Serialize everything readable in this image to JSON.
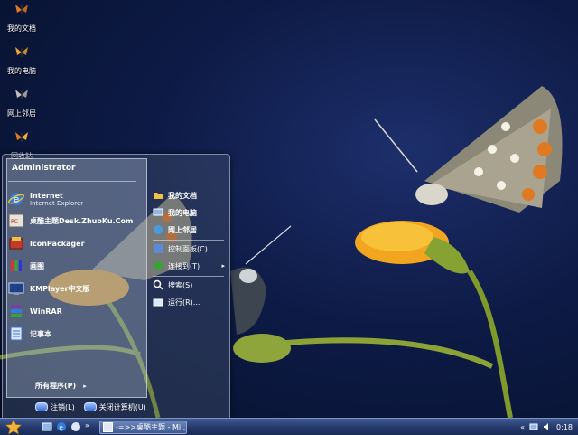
{
  "desktop": {
    "icons": [
      {
        "label": "我的文档",
        "icon": "butterfly-documents-icon"
      },
      {
        "label": "我的电脑",
        "icon": "butterfly-computer-icon"
      },
      {
        "label": "网上邻居",
        "icon": "butterfly-network-icon"
      },
      {
        "label": "回收站",
        "icon": "butterfly-recycle-icon"
      }
    ]
  },
  "start_menu": {
    "user": "Administrator",
    "pinned": [
      {
        "label": "Internet",
        "sub": "Internet Explorer",
        "icon": "ie-icon"
      },
      {
        "label": "桌酷主题Desk.ZhuoKu.Com",
        "icon": "desktop-theme-icon"
      },
      {
        "label": "IconPackager",
        "icon": "iconpackager-icon"
      },
      {
        "label": "画图",
        "icon": "paint-icon"
      },
      {
        "label": "KMPlayer中文版",
        "icon": "kmplayer-icon"
      },
      {
        "label": "WinRAR",
        "icon": "winrar-icon"
      },
      {
        "label": "记事本",
        "icon": "notepad-icon"
      }
    ],
    "all_programs": "所有程序(P)",
    "right": [
      {
        "label": "我的文档",
        "icon": "documents-icon"
      },
      {
        "label": "我的电脑",
        "icon": "computer-icon"
      },
      {
        "label": "网上邻居",
        "icon": "network-icon"
      },
      {
        "label": "控制面板(C)",
        "icon": "control-panel-icon"
      },
      {
        "label": "连接到(T)",
        "icon": "connect-icon",
        "arrow": "▸"
      },
      {
        "label": "搜索(S)",
        "icon": "search-icon"
      },
      {
        "label": "运行(R)...",
        "icon": "run-icon"
      }
    ],
    "logoff": "注销(L)",
    "shutdown": "关闭计算机(U)"
  },
  "taskbar": {
    "window_title": "-=>>桌酷主题 - Mi...",
    "clock": "0:18"
  },
  "colors": {
    "accent": "#3c6fd6",
    "taskbar": "#24386a",
    "sky": "#0d1a45"
  }
}
